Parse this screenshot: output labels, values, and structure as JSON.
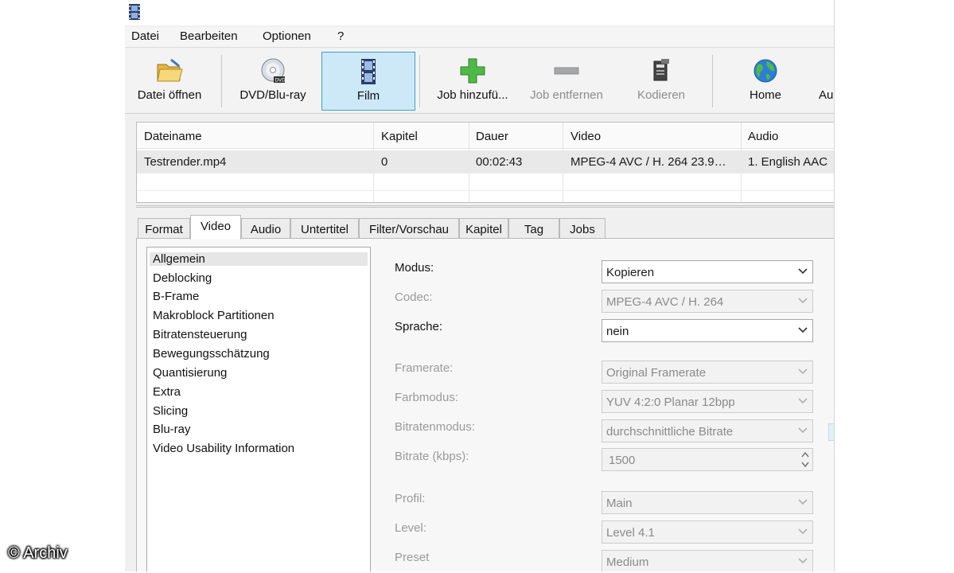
{
  "menu": [
    "Datei",
    "Bearbeiten",
    "Optionen",
    "?"
  ],
  "toolbar": {
    "open_file": "Datei öffnen",
    "dvd_bluray": "DVD/Blu-ray",
    "film": "Film",
    "add_job": "Job hinzufü...",
    "remove_job": "Job entfernen",
    "encode": "Kodieren",
    "home": "Home",
    "cut_off": "Au"
  },
  "file_table": {
    "columns": [
      "Dateiname",
      "Kapitel",
      "Dauer",
      "Video",
      "Audio"
    ],
    "rows": [
      [
        "Testrender.mp4",
        "0",
        "00:02:43",
        "MPEG-4 AVC / H. 264 23.9…",
        "1. English AAC"
      ]
    ]
  },
  "tabs": [
    "Format",
    "Video",
    "Audio",
    "Untertitel",
    "Filter/Vorschau",
    "Kapitel",
    "Tag",
    "Jobs"
  ],
  "active_tab": "Video",
  "categories": [
    "Allgemein",
    "Deblocking",
    "B-Frame",
    "Makroblock Partitionen",
    "Bitratensteuerung",
    "Bewegungsschätzung",
    "Quantisierung",
    "Extra",
    "Slicing",
    "Blu-ray",
    "Video Usability Information"
  ],
  "selected_category": "Allgemein",
  "settings": {
    "modus": {
      "label": "Modus:",
      "value": "Kopieren",
      "enabled": true
    },
    "codec": {
      "label": "Codec:",
      "value": "MPEG-4 AVC / H. 264",
      "enabled": false
    },
    "sprache": {
      "label": "Sprache:",
      "value": "nein",
      "enabled": true
    },
    "framerate": {
      "label": "Framerate:",
      "value": "Original Framerate",
      "enabled": false
    },
    "farbmodus": {
      "label": "Farbmodus:",
      "value": "YUV 4:2:0 Planar 12bpp",
      "enabled": false
    },
    "bitratenmodus": {
      "label": "Bitratenmodus:",
      "value": "durchschnittliche Bitrate",
      "enabled": false
    },
    "bitrate": {
      "label": "Bitrate (kbps):",
      "value": "1500",
      "enabled": false
    },
    "profil": {
      "label": "Profil:",
      "value": "Main",
      "enabled": false
    },
    "level": {
      "label": "Level:",
      "value": "Level 4.1",
      "enabled": false
    },
    "preset": {
      "label": "Preset",
      "value": "Medium",
      "enabled": false
    }
  },
  "watermark": "© Archiv",
  "colors": {
    "active_button_bg": "#cde8f7",
    "active_button_border": "#3c9fd6",
    "disabled_text": "#9a9a9a"
  }
}
